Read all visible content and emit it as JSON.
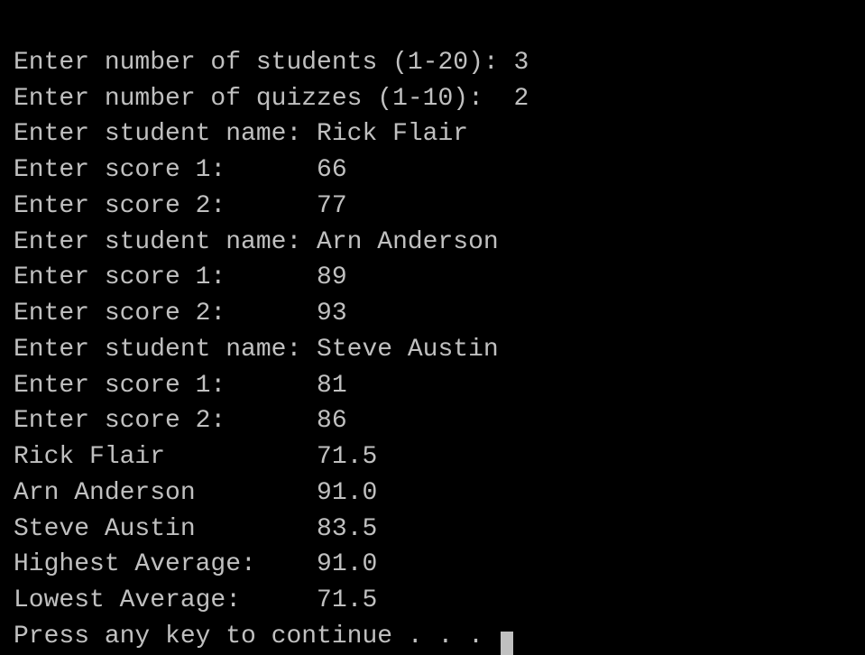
{
  "terminal": {
    "lines": [
      {
        "id": "line-1",
        "text": "Enter number of students (1-20): 3"
      },
      {
        "id": "line-2",
        "text": "Enter number of quizzes (1-10):  2"
      },
      {
        "id": "line-3",
        "text": ""
      },
      {
        "id": "line-4",
        "text": "Enter student name: Rick Flair"
      },
      {
        "id": "line-5",
        "text": "Enter score 1:      66"
      },
      {
        "id": "line-6",
        "text": "Enter score 2:      77"
      },
      {
        "id": "line-7",
        "text": "Enter student name: Arn Anderson"
      },
      {
        "id": "line-8",
        "text": "Enter score 1:      89"
      },
      {
        "id": "line-9",
        "text": "Enter score 2:      93"
      },
      {
        "id": "line-10",
        "text": "Enter student name: Steve Austin"
      },
      {
        "id": "line-11",
        "text": "Enter score 1:      81"
      },
      {
        "id": "line-12",
        "text": "Enter score 2:      86"
      },
      {
        "id": "line-13",
        "text": "Rick Flair          71.5"
      },
      {
        "id": "line-14",
        "text": "Arn Anderson        91.0"
      },
      {
        "id": "line-15",
        "text": "Steve Austin        83.5"
      },
      {
        "id": "line-16",
        "text": "Highest Average:    91.0"
      },
      {
        "id": "line-17",
        "text": "Lowest Average:     71.5"
      },
      {
        "id": "line-18",
        "text": "Press any key to continue . . . "
      }
    ],
    "cursor_visible": true
  }
}
